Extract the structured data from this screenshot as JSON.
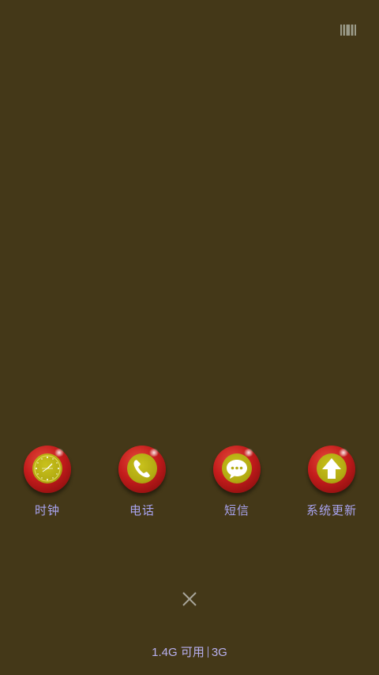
{
  "top_icon": "battery-bars-icon",
  "apps": [
    {
      "label": "时钟",
      "icon": "clock-icon"
    },
    {
      "label": "电话",
      "icon": "phone-icon"
    },
    {
      "label": "短信",
      "icon": "message-icon"
    },
    {
      "label": "系统更新",
      "icon": "update-arrow-icon"
    }
  ],
  "close_icon": "close-icon",
  "status": {
    "memory": "1.4G 可用",
    "network": "3G"
  },
  "colors": {
    "background": "#443818",
    "ball_red": "#c41c1c",
    "inner_yellow": "#b3ab12",
    "label_text": "#a9a4f0"
  }
}
